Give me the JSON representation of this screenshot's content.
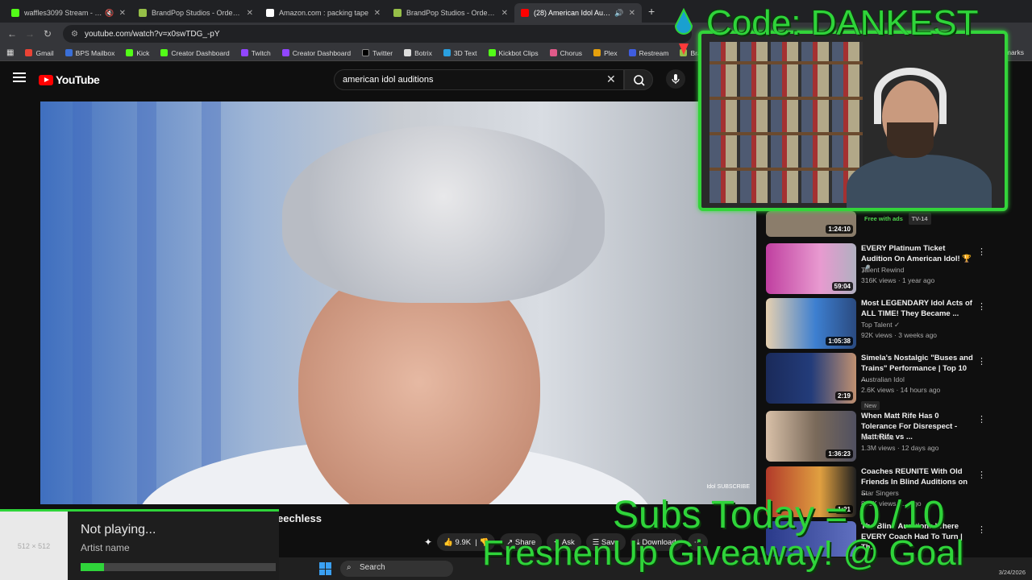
{
  "browser": {
    "tabs": [
      {
        "label": "waffles3099 Stream - Watch",
        "favicon_color": "#53fc18"
      },
      {
        "label": "BrandPop Studios - Orders - #1",
        "favicon_color": "#96bf48"
      },
      {
        "label": "Amazon.com : packing tape",
        "favicon_color": "#ffffff"
      },
      {
        "label": "BrandPop Studios - Orders - #1",
        "favicon_color": "#96bf48"
      },
      {
        "label": "(28) American Idol Audition",
        "favicon_color": "#ff0000"
      }
    ],
    "url": "youtube.com/watch?v=x0swTDG_-pY",
    "bookmarks": [
      "Gmail",
      "BPS Mailbox",
      "Kick",
      "Creator Dashboard",
      "Twitch",
      "Creator Dashboard",
      "Twitter",
      "Botrix",
      "3D Text",
      "Kickbot Clips",
      "Chorus",
      "Plex",
      "Restream",
      "BrandPop"
    ],
    "bookmarks_right": "marks"
  },
  "youtube": {
    "logo_text": "YouTube",
    "search_value": "american idol auditions",
    "video_title_partial": "eechless",
    "watermark": "Idol SUBSCRIBE",
    "actions": {
      "like_count": "9.9K",
      "share": "Share",
      "ask": "Ask",
      "save": "Save",
      "download": "Download"
    },
    "recommendations": [
      {
        "title": "",
        "channel": "",
        "meta": "",
        "duration": "1:24:10",
        "badge1": "Free with ads",
        "badge2": "TV-14",
        "thumb_color": "#8b7d6b"
      },
      {
        "title": "EVERY Platinum Ticket Audition On American Idol! 🏆🎤",
        "channel": "Talent Rewind",
        "meta": "316K views · 1 year ago",
        "duration": "59:04",
        "thumb_color": "#c03fa0"
      },
      {
        "title": "Most LEGENDARY Idol Acts of ALL TIME! They Became ...",
        "channel": "Top Talent ✓",
        "meta": "92K views · 3 weeks ago",
        "duration": "1:05:38",
        "thumb_color": "#3d7fd0"
      },
      {
        "title": "Simela's Nostalgic \"Buses and Trains\" Performance | Top 10 ...",
        "channel": "Australian Idol",
        "meta": "2.6K views · 14 hours ago",
        "duration": "2:19",
        "badge1": "New",
        "thumb_color": "#233c7a"
      },
      {
        "title": "When Matt Rife Has 0 Tolerance For Disrespect - Matt Rife vs ...",
        "channel": "NHT News",
        "meta": "1.3M views · 12 days ago",
        "duration": "1:36:23",
        "thumb_color": "#7a6a5a"
      },
      {
        "title": "Coaches REUNITE With Old Friends In Blind Auditions on ...",
        "channel": "Star Singers",
        "meta": "815K views · ... ago",
        "duration": "1:21",
        "thumb_color": "#b23a2a"
      },
      {
        "title": "The Blind Auditions Where EVERY Coach Had To Turn | Th...",
        "channel": "",
        "meta": "",
        "duration": "",
        "thumb_color": "#2a3a8a"
      }
    ]
  },
  "overlay": {
    "code_text": "Code: DANKEST",
    "subs_text": "Subs Today = 0   /10",
    "giveaway_text": "FreshenUp Giveaway! @ Goal",
    "accent": "#2fd43a"
  },
  "now_playing": {
    "art_placeholder": "512 × 512",
    "title": "Not playing...",
    "artist": "Artist name",
    "progress": 0.12
  },
  "taskbar": {
    "search_label": "Search",
    "date": "3/24/2026"
  }
}
